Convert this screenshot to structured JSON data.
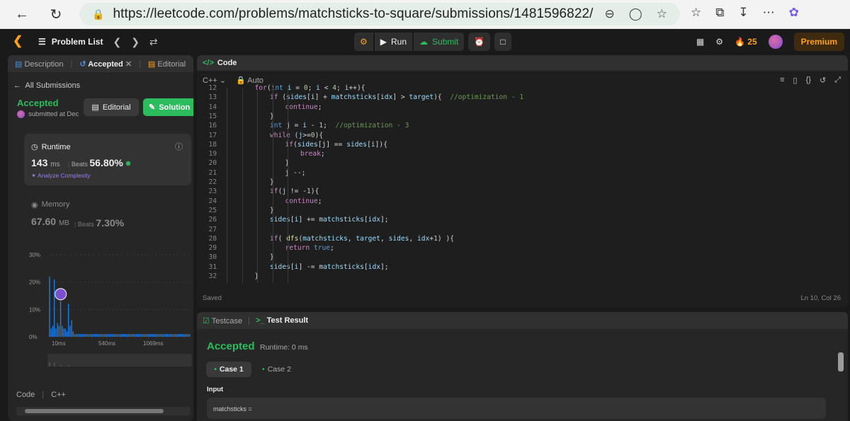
{
  "browser": {
    "url": "https://leetcode.com/problems/matchsticks-to-square/submissions/1481596822/"
  },
  "topbar": {
    "problem_list": "Problem List",
    "run": "Run",
    "submit": "Submit",
    "streak": "25",
    "premium": "Premium"
  },
  "left": {
    "tabs": [
      "Description",
      "Accepted",
      "Editorial"
    ],
    "all_submissions": "All Submissions",
    "status": "Accepted",
    "submitted_at": "submitted at Dec",
    "editorial_btn": "Editorial",
    "solution_btn": "Solution",
    "runtime_label": "Runtime",
    "runtime_value": "143",
    "runtime_unit": "ms",
    "beats_label": "Beats",
    "runtime_beats": "56.80%",
    "analyze": "Analyze Complexity",
    "memory_label": "Memory",
    "memory_value": "67.60",
    "memory_unit": "MB",
    "memory_beats": "7.30%",
    "code_label": "Code",
    "lang": "C++"
  },
  "chart_data": {
    "type": "bar",
    "title": "",
    "yticks": [
      "30%",
      "20%",
      "10%",
      "0%"
    ],
    "xticks": [
      "10ms",
      "540ms",
      "1069ms"
    ],
    "mini_xticks": [
      "10ms",
      "540ms",
      "1069ms"
    ],
    "ylim": [
      0,
      30
    ],
    "values": [
      22,
      3,
      4,
      21,
      3,
      5,
      4,
      13,
      4,
      3,
      3,
      2,
      12,
      4,
      6,
      2,
      1,
      1,
      1,
      1,
      1,
      1,
      1,
      1,
      1,
      1,
      1,
      1,
      1,
      1,
      1,
      1,
      1,
      1,
      1,
      1,
      1,
      1,
      1,
      1,
      1,
      1,
      1,
      1,
      1,
      1,
      1,
      1,
      1,
      1,
      1,
      1,
      1,
      1,
      1,
      1,
      1,
      1,
      1,
      1,
      1,
      1,
      1,
      1,
      1,
      1,
      1,
      1,
      1,
      1,
      1,
      1,
      1,
      1,
      1,
      1,
      1,
      1,
      1,
      1,
      1,
      1,
      1,
      1,
      1,
      1,
      1,
      1,
      1,
      1
    ],
    "color": "#1e7be0",
    "highlight_index": 7
  },
  "code_panel": {
    "title": "Code",
    "lang": "C++",
    "auto": "Auto",
    "saved": "Saved",
    "cursor": "Ln 10, Col 26",
    "lines": [
      {
        "n": "12",
        "ind": 3,
        "txt": "for(int i = 0; i < 4; i++){"
      },
      {
        "n": "13",
        "ind": 4,
        "txt": "if (sides[i] + matchsticks[idx] > target){  //optimization - 1"
      },
      {
        "n": "14",
        "ind": 5,
        "txt": "continue;"
      },
      {
        "n": "15",
        "ind": 4,
        "txt": "}"
      },
      {
        "n": "16",
        "ind": 4,
        "txt": "int j = i - 1;  //optimization - 3"
      },
      {
        "n": "17",
        "ind": 4,
        "txt": "while (j>=0){"
      },
      {
        "n": "18",
        "ind": 5,
        "txt": "if(sides[j] == sides[i]){"
      },
      {
        "n": "19",
        "ind": 6,
        "txt": "break;"
      },
      {
        "n": "20",
        "ind": 5,
        "txt": "}"
      },
      {
        "n": "21",
        "ind": 5,
        "txt": "j --;"
      },
      {
        "n": "22",
        "ind": 4,
        "txt": "}"
      },
      {
        "n": "23",
        "ind": 4,
        "txt": "if(j != -1){"
      },
      {
        "n": "24",
        "ind": 5,
        "txt": "continue;"
      },
      {
        "n": "25",
        "ind": 4,
        "txt": "}"
      },
      {
        "n": "26",
        "ind": 4,
        "txt": "sides[i] += matchsticks[idx];"
      },
      {
        "n": "27",
        "ind": 4,
        "txt": ""
      },
      {
        "n": "28",
        "ind": 4,
        "txt": "if( dfs(matchsticks, target, sides, idx+1) ){"
      },
      {
        "n": "29",
        "ind": 5,
        "txt": "return true;"
      },
      {
        "n": "30",
        "ind": 4,
        "txt": "}"
      },
      {
        "n": "31",
        "ind": 4,
        "txt": "sides[i] -= matchsticks[idx];"
      },
      {
        "n": "32",
        "ind": 3,
        "txt": "}"
      }
    ]
  },
  "test_panel": {
    "tab1": "Testcase",
    "tab2": "Test Result",
    "status": "Accepted",
    "runtime": "Runtime: 0 ms",
    "case1": "Case 1",
    "case2": "Case 2",
    "input_label": "Input",
    "input_value": "matchsticks ="
  }
}
